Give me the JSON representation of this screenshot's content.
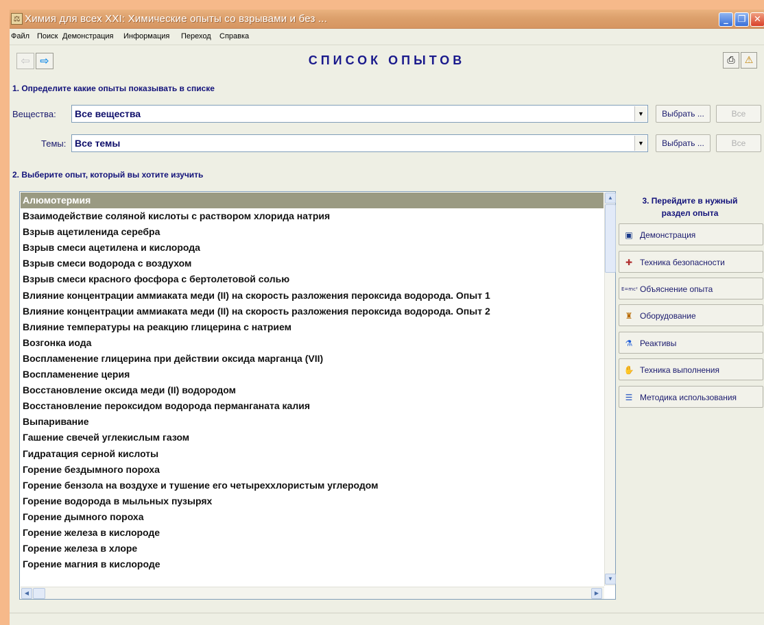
{
  "window": {
    "title": "Химия для всех XXI: Химические опыты со взрывами и без ...",
    "controls": {
      "minimize": "_",
      "maximize": "❐",
      "close": "✕"
    }
  },
  "menu": [
    "Файл",
    "Поиск",
    "Демонстрация",
    "Информация",
    "Переход",
    "Справка"
  ],
  "toolbar": {
    "title": "СПИСОК ОПЫТОВ",
    "back_icon": "left-arrow-icon",
    "forward_icon": "right-arrow-icon",
    "print_icon": "printer-icon",
    "help_icon": "help-icon"
  },
  "step1": {
    "heading": "1. Определите какие опыты показывать в списке",
    "substances": {
      "label": "Вещества:",
      "value": "Все вещества",
      "choose": "Выбрать ...",
      "all": "Все"
    },
    "topics": {
      "label": "Темы:",
      "value": "Все темы",
      "choose": "Выбрать ...",
      "all": "Все"
    }
  },
  "step2": {
    "heading": "2. Выберите опыт, который вы хотите изучить",
    "selected_index": 0,
    "items": [
      "Алюмотермия",
      "Взаимодействие соляной кислоты с раствором хлорида натрия",
      "Взрыв ацетиленида серебра",
      "Взрыв смеси ацетилена и кислорода",
      "Взрыв смеси водорода с воздухом",
      "Взрыв смеси красного фосфора с бертолетовой солью",
      "Влияние концентрации аммиаката меди (II) на скорость разложения пероксида водорода. Опыт 1",
      "Влияние концентрации аммиаката меди (II) на скорость разложения пероксида водорода. Опыт 2",
      "Влияние температуры на реакцию глицерина с натрием",
      "Возгонка иода",
      "Воспламенение глицерина при действии оксида марганца (VII)",
      "Воспламенение церия",
      "Восстановление оксида меди (II) водородом",
      "Восстановление пероксидом водорода перманганата калия",
      "Выпаривание",
      "Гашение свечей углекислым газом",
      "Гидратация серной кислоты",
      "Горение бездымного пороха",
      "Горение бензола на воздухе и тушение его четыреххлористым углеродом",
      "Горение водорода в мыльных пузырях",
      "Горение дымного пороха",
      "Горение железа в кислороде",
      "Горение железа в хлоре",
      "Горение магния в кислороде"
    ]
  },
  "step3": {
    "heading_line1": "3. Перейдите в нужный",
    "heading_line2": "раздел опыта",
    "sections": [
      {
        "label": "Демонстрация",
        "icon": "film-icon",
        "glyph": "▣",
        "color": "#1a3a8a"
      },
      {
        "label": "Техника безопасности",
        "icon": "safety-kit-icon",
        "glyph": "✚",
        "color": "#b03030"
      },
      {
        "label": "Объяснение опыта",
        "icon": "formula-icon",
        "glyph": "E=mc²",
        "color": "#1a1a6e"
      },
      {
        "label": "Оборудование",
        "icon": "equipment-icon",
        "glyph": "♜",
        "color": "#b86a00"
      },
      {
        "label": "Реактивы",
        "icon": "flask-icon",
        "glyph": "⚗",
        "color": "#1a5ad8"
      },
      {
        "label": "Техника выполнения",
        "icon": "hand-tool-icon",
        "glyph": "✋",
        "color": "#c04020"
      },
      {
        "label": "Методика  использования",
        "icon": "list-icon",
        "glyph": "☰",
        "color": "#2050c0"
      }
    ]
  }
}
